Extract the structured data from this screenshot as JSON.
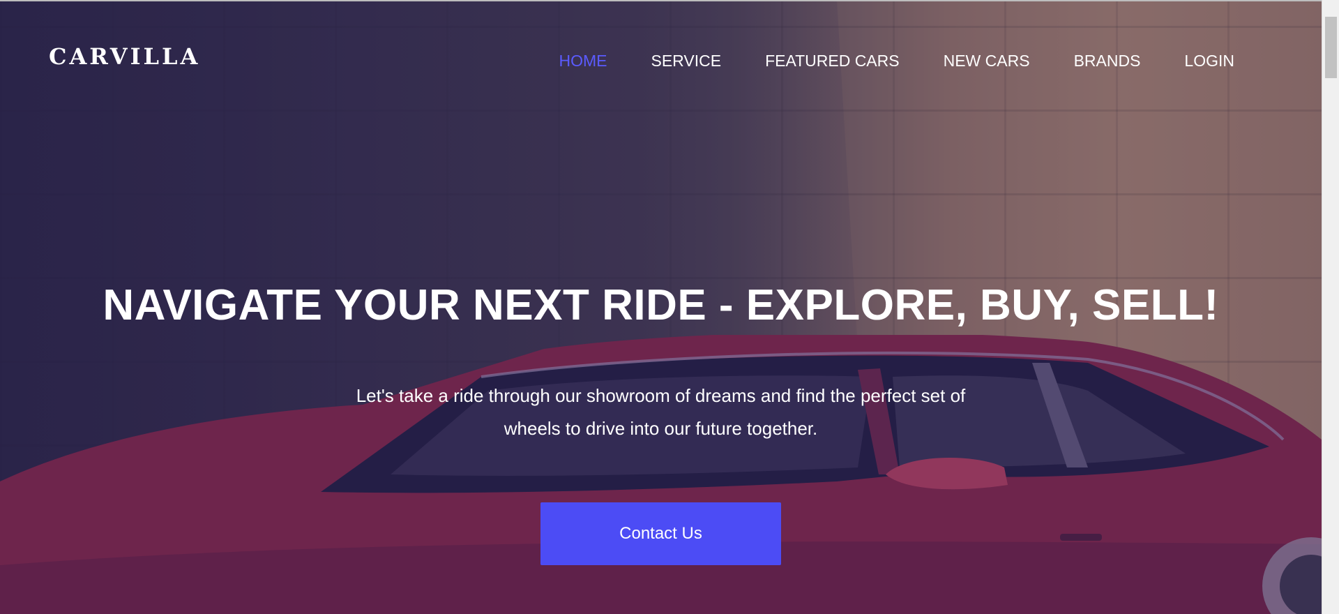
{
  "header": {
    "logo": "CARVILLA",
    "nav": [
      {
        "label": "HOME",
        "active": true
      },
      {
        "label": "SERVICE",
        "active": false
      },
      {
        "label": "FEATURED CARS",
        "active": false
      },
      {
        "label": "NEW CARS",
        "active": false
      },
      {
        "label": "BRANDS",
        "active": false
      },
      {
        "label": "LOGIN",
        "active": false
      }
    ]
  },
  "hero": {
    "headline": "NAVIGATE YOUR NEXT RIDE - EXPLORE, BUY, SELL!",
    "subtext_line1": "Let's take a ride through our showroom of dreams and find the perfect set of",
    "subtext_line2": "wheels to drive into our future together.",
    "cta_label": "Contact Us",
    "background_image": "red-sedan-against-stone-wall"
  },
  "colors": {
    "accent": "#4c4cf5",
    "nav_active": "#5b5bff",
    "text": "#ffffff"
  }
}
